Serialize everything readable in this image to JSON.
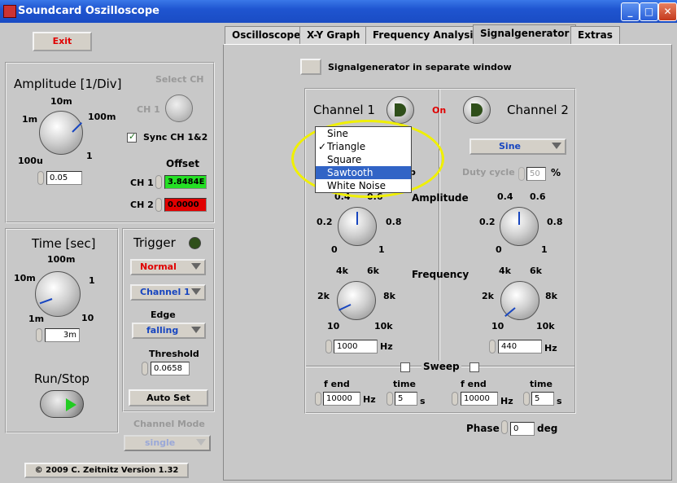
{
  "window": {
    "title": "Soundcard Oszilloscope",
    "min": "_",
    "max": "□",
    "close": "✕"
  },
  "left": {
    "exit": "Exit",
    "amplitude_title": "Amplitude [1/Div]",
    "amp_ticks": [
      "10m",
      "100m",
      "1m",
      "1",
      "100u"
    ],
    "amp_value": "0.05",
    "select_ch": "Select CH",
    "ch1": "CH 1",
    "sync": "Sync CH 1&2",
    "offset": "Offset",
    "ch1_label": "CH 1",
    "ch1_offset": "3.8484E",
    "ch2_label": "CH 2",
    "ch2_offset": "0.0000",
    "time_title": "Time [sec]",
    "time_ticks": [
      "100m",
      "10m",
      "1",
      "1m",
      "10"
    ],
    "time_value": "3m",
    "runstop": "Run/Stop",
    "trigger": "Trigger",
    "trig_mode": "Normal",
    "trig_channel": "Channel 1",
    "edge": "Edge",
    "edge_value": "falling",
    "threshold": "Threshold",
    "threshold_value": "0.0658",
    "autoset": "Auto Set",
    "channel_mode": "Channel Mode",
    "channel_mode_value": "single",
    "copyright": "© 2009  C. Zeitnitz Version 1.32"
  },
  "tabs": [
    "Oscilloscope",
    "X-Y Graph",
    "Frequency Analysis",
    "Signalgenerator",
    "Extras"
  ],
  "siggen": {
    "separate_window": "Signalgenerator in separate window",
    "channel1": "Channel 1",
    "on": "On",
    "channel2": "Channel 2",
    "ch1_menu": [
      "Sine",
      "Triangle",
      "Square",
      "Sawtooth",
      "White Noise"
    ],
    "ch1_checked": "✓",
    "ch2_wave": "Sine",
    "duty_cycle": "Duty cycle",
    "duty_value": "50",
    "percent": "%",
    "p_fragment": "p",
    "amplitude": "Amplitude",
    "amp_ticks": [
      "0.4",
      "0.6",
      "0.2",
      "0.8",
      "0",
      "1"
    ],
    "frequency": "Frequency",
    "freq_ticks": [
      "4k",
      "6k",
      "2k",
      "8k",
      "10",
      "10k"
    ],
    "ch1_freq": "1000",
    "ch2_freq": "440",
    "hz": "Hz",
    "sweep": "Sweep",
    "f_end": "f end",
    "time": "time",
    "ch1_fend": "10000",
    "ch1_time": "5",
    "ch2_fend": "10000",
    "ch2_time": "5",
    "s": "s",
    "phase": "Phase",
    "phase_value": "0",
    "deg": "deg"
  },
  "colors": {
    "accent_red": "#e00000",
    "led_green": "#3a5f1a",
    "highlight": "#f0f000",
    "selection": "#3164c6"
  }
}
